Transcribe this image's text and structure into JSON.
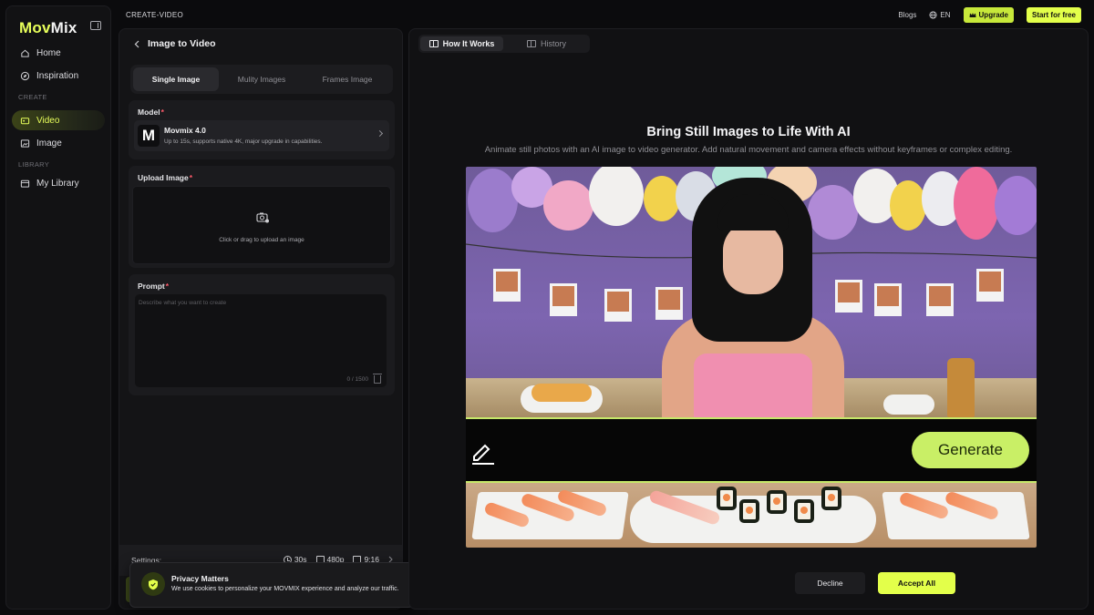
{
  "brand": {
    "logo_accent": "Mov",
    "logo_rest": "Mix"
  },
  "sidebar": {
    "items": [
      {
        "label": "Home",
        "icon": "home-icon"
      },
      {
        "label": "Inspiration",
        "icon": "compass-icon"
      },
      {
        "label": "Video",
        "icon": "video-icon",
        "active": true
      },
      {
        "label": "Image",
        "icon": "image-icon"
      },
      {
        "label": "My Library",
        "icon": "folder-icon"
      }
    ],
    "sections": {
      "create": "CREATE",
      "library": "LIBRARY"
    }
  },
  "topbar": {
    "breadcrumb": "CREATE-VIDEO",
    "blogs": "Blogs",
    "language": "EN",
    "upgrade": "Upgrade",
    "start_free": "Start for free"
  },
  "panel": {
    "title": "Image to Video",
    "modes": [
      "Single Image",
      "Mulity Images",
      "Frames Image"
    ],
    "active_mode": "Single Image",
    "model": {
      "label": "Model",
      "name": "Movmix 4.0",
      "description": "Up to 15s, supports native 4K, major upgrade in capabilities.",
      "logo_letter": "M"
    },
    "upload": {
      "label": "Upload Image",
      "hint": "Click or drag to upload an image"
    },
    "prompt": {
      "label": "Prompt",
      "placeholder": "Describe what you want to create",
      "counter": "0 / 1500"
    },
    "settings": {
      "label": "Settings:",
      "duration": "30s",
      "resolution": "480p",
      "ratio": "9:16"
    }
  },
  "cookie": {
    "title": "Privacy Matters",
    "text": "We use cookies to personalize your MOVMIX experience and analyze our traffic.",
    "decline": "Decline",
    "accept": "Accept All"
  },
  "main": {
    "tabs": [
      "How It Works",
      "History"
    ],
    "active_tab": "How It Works",
    "hero_title": "Bring Still Images to Life With AI",
    "hero_subtitle": "Animate still photos with an AI image to video generator. Add natural movement and camera effects without keyframes or complex editing.",
    "generate_label": "Generate"
  },
  "colors": {
    "accent": "#e3ff4a",
    "generate": "#c9ef66",
    "required": "#ff5a6a"
  }
}
